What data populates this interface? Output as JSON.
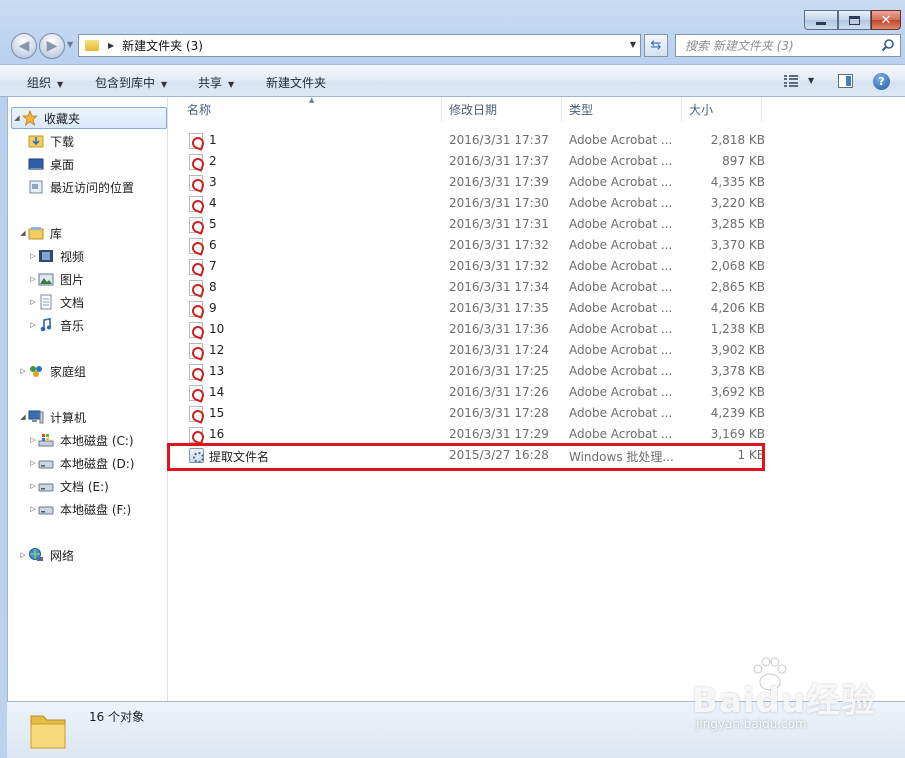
{
  "window": {
    "address_folder": "新建文件夹 (3)",
    "search_placeholder": "搜索 新建文件夹 (3)"
  },
  "toolbar": {
    "organize": "组织",
    "include_in_library": "包含到库中",
    "share": "共享",
    "new_folder": "新建文件夹"
  },
  "nav": {
    "favorites": "收藏夹",
    "downloads": "下载",
    "desktop": "桌面",
    "recent_places": "最近访问的位置",
    "libraries": "库",
    "videos": "视频",
    "pictures": "图片",
    "documents": "文档",
    "music": "音乐",
    "homegroup": "家庭组",
    "computer": "计算机",
    "disk_c": "本地磁盘 (C:)",
    "disk_d": "本地磁盘 (D:)",
    "disk_e": "文档 (E:)",
    "disk_f": "本地磁盘 (F:)",
    "network": "网络"
  },
  "columns": {
    "name": "名称",
    "date": "修改日期",
    "type": "类型",
    "size": "大小"
  },
  "files": [
    {
      "name": "1",
      "date": "2016/3/31 17:37",
      "type": "Adobe Acrobat ...",
      "size": "2,818 KB",
      "icon": "pdf-icon"
    },
    {
      "name": "2",
      "date": "2016/3/31 17:37",
      "type": "Adobe Acrobat ...",
      "size": "897 KB",
      "icon": "pdf-icon"
    },
    {
      "name": "3",
      "date": "2016/3/31 17:39",
      "type": "Adobe Acrobat ...",
      "size": "4,335 KB",
      "icon": "pdf-icon"
    },
    {
      "name": "4",
      "date": "2016/3/31 17:30",
      "type": "Adobe Acrobat ...",
      "size": "3,220 KB",
      "icon": "pdf-icon"
    },
    {
      "name": "5",
      "date": "2016/3/31 17:31",
      "type": "Adobe Acrobat ...",
      "size": "3,285 KB",
      "icon": "pdf-icon"
    },
    {
      "name": "6",
      "date": "2016/3/31 17:32",
      "type": "Adobe Acrobat ...",
      "size": "3,370 KB",
      "icon": "pdf-icon"
    },
    {
      "name": "7",
      "date": "2016/3/31 17:32",
      "type": "Adobe Acrobat ...",
      "size": "2,068 KB",
      "icon": "pdf-icon"
    },
    {
      "name": "8",
      "date": "2016/3/31 17:34",
      "type": "Adobe Acrobat ...",
      "size": "2,865 KB",
      "icon": "pdf-icon"
    },
    {
      "name": "9",
      "date": "2016/3/31 17:35",
      "type": "Adobe Acrobat ...",
      "size": "4,206 KB",
      "icon": "pdf-icon"
    },
    {
      "name": "10",
      "date": "2016/3/31 17:36",
      "type": "Adobe Acrobat ...",
      "size": "1,238 KB",
      "icon": "pdf-icon"
    },
    {
      "name": "12",
      "date": "2016/3/31 17:24",
      "type": "Adobe Acrobat ...",
      "size": "3,902 KB",
      "icon": "pdf-icon"
    },
    {
      "name": "13",
      "date": "2016/3/31 17:25",
      "type": "Adobe Acrobat ...",
      "size": "3,378 KB",
      "icon": "pdf-icon"
    },
    {
      "name": "14",
      "date": "2016/3/31 17:26",
      "type": "Adobe Acrobat ...",
      "size": "3,692 KB",
      "icon": "pdf-icon"
    },
    {
      "name": "15",
      "date": "2016/3/31 17:28",
      "type": "Adobe Acrobat ...",
      "size": "4,239 KB",
      "icon": "pdf-icon"
    },
    {
      "name": "16",
      "date": "2016/3/31 17:29",
      "type": "Adobe Acrobat ...",
      "size": "3,169 KB",
      "icon": "pdf-icon"
    },
    {
      "name": "提取文件名",
      "date": "2015/3/27 16:28",
      "type": "Windows 批处理...",
      "size": "1 KB",
      "icon": "batch-file-icon"
    }
  ],
  "status": {
    "count": "16 个对象"
  },
  "watermark": {
    "logo": "Baidu经验",
    "url": "jingyan.baidu.com"
  },
  "colors": {
    "highlight": "#e1141c",
    "selection": "#d9e8fb"
  }
}
